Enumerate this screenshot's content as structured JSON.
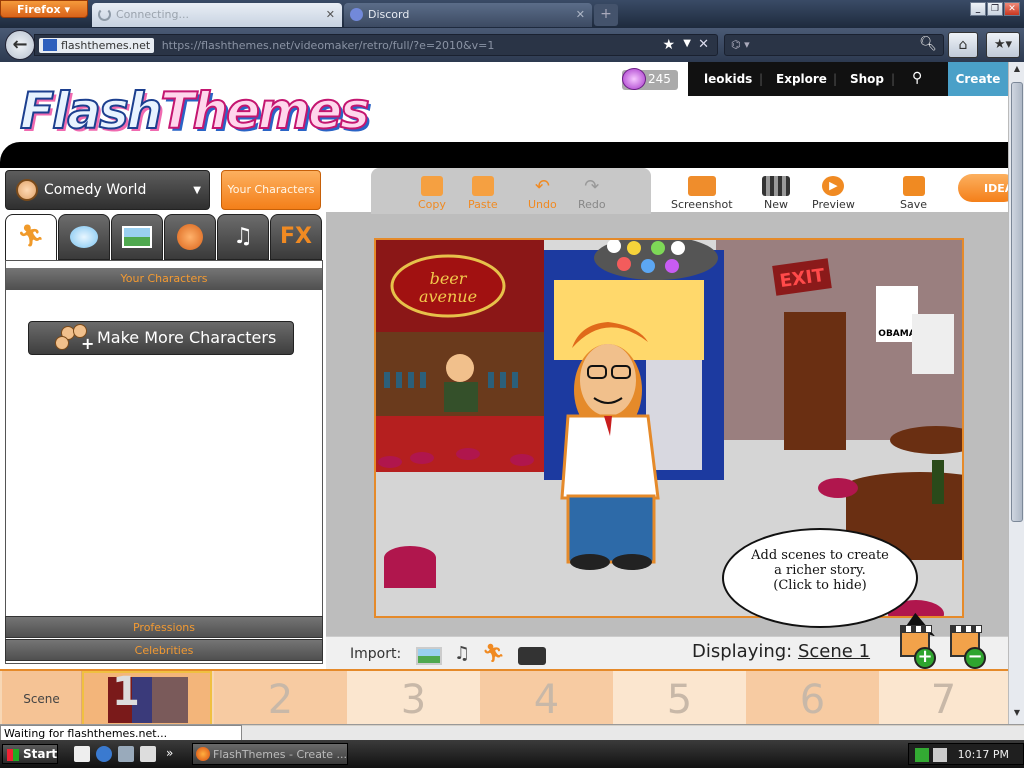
{
  "browser": {
    "menu_label": "Firefox",
    "tabs": [
      {
        "title": "Connecting...",
        "close": "✕"
      },
      {
        "title": "Discord",
        "close": "✕"
      }
    ],
    "new_tab": "+",
    "window_buttons": [
      "_",
      "❐",
      "✕"
    ],
    "url_site": "flashthemes.net",
    "url_path": "https://flashthemes.net/videomaker/retro/full/?e=2010&v=1",
    "search_placeholder": "",
    "back_icon": "back-arrow-icon",
    "home_icon": "home-icon"
  },
  "site": {
    "logo_part1": "Flash",
    "logo_part2": "Themes",
    "coins": "245",
    "nav": {
      "user": "leokids",
      "explore": "Explore",
      "shop": "Shop",
      "create": "Create"
    }
  },
  "editor": {
    "theme_select": "Comedy World",
    "your_characters": "Your Characters",
    "category_tabs": [
      "characters",
      "bubbles",
      "backgrounds",
      "props",
      "sounds",
      "FX"
    ],
    "fx_label": "FX",
    "library_header": "Your Characters",
    "make_more": "Make More Characters",
    "footer_sections": [
      "Professions",
      "Celebrities"
    ],
    "toolbar_left": [
      "Copy",
      "Paste",
      "Undo",
      "Redo"
    ],
    "toolbar_right": [
      "Screenshot",
      "New",
      "Preview",
      "Save"
    ],
    "ideas": "IDEAS",
    "stage_signs": {
      "bar": "beer avenue",
      "exit": "EXIT",
      "poster": "OBAMA"
    },
    "bubble_text": [
      "Add scenes to create",
      "a richer story.",
      "(Click to hide)"
    ],
    "import_label": "Import:",
    "displaying_label": "Displaying:",
    "current_scene": "Scene 1",
    "timeline_label": "Scene",
    "timeline_numbers": [
      "2",
      "3",
      "4",
      "5",
      "6",
      "7"
    ],
    "thumb_number": "1"
  },
  "status_text": "Waiting for flashthemes.net...",
  "taskbar": {
    "start": "Start",
    "task": "FlashThemes - Create ...",
    "clock": "10:17 PM",
    "more": "»"
  },
  "colors": {
    "accent_orange": "#f08a22",
    "create_blue": "#4aa0c8",
    "stage_border": "#e58a2a"
  }
}
